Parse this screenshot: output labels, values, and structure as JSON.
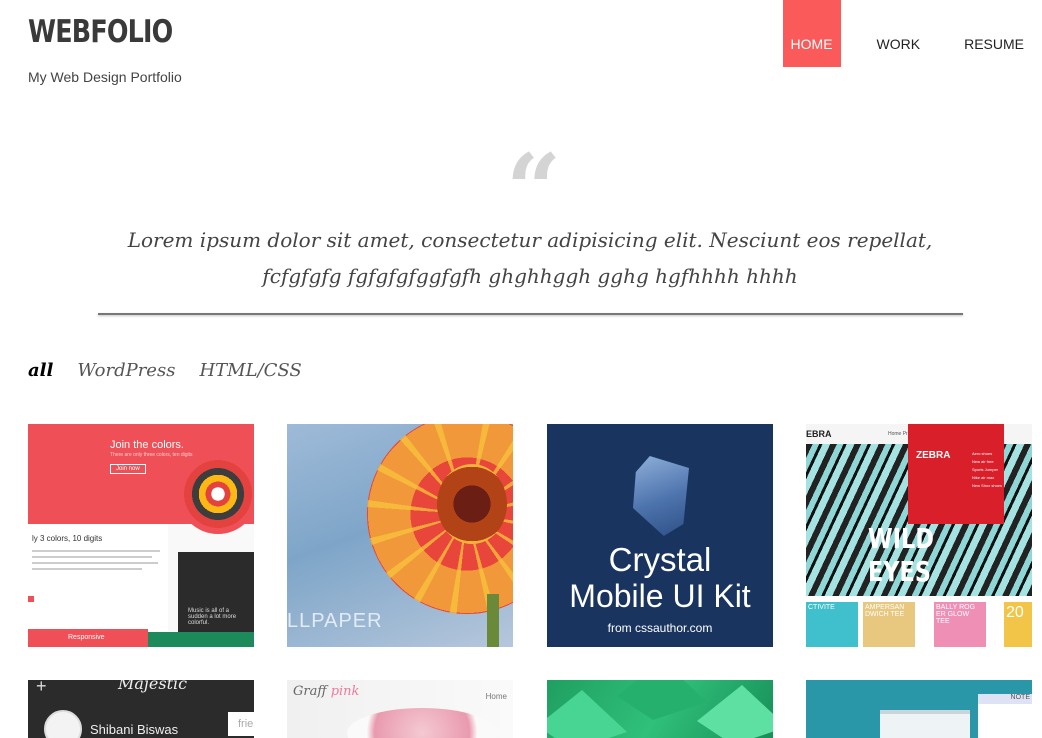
{
  "header": {
    "logo": "WEBFOLIO",
    "tagline": "My Web Design Portfolio",
    "nav": [
      {
        "label": "HOME",
        "active": true
      },
      {
        "label": "WORK",
        "active": false
      },
      {
        "label": "RESUME",
        "active": false
      }
    ]
  },
  "quote": {
    "mark": "“",
    "text": "Lorem ipsum dolor sit amet, consectetur adipisicing elit. Nesciunt eos repellat, fcfgfgfg fgfgfgfggfgfh ghghhggh gghg hgfhhhh hhhh"
  },
  "filters": [
    {
      "label": "all",
      "active": true
    },
    {
      "label": "WordPress",
      "active": false
    },
    {
      "label": "HTML/CSS",
      "active": false
    }
  ],
  "portfolio": {
    "tile1": {
      "heading": "Join the colors.",
      "sub": "There are only three colors, ten digits",
      "button": "Join now",
      "body_heading": "ly 3 colors, 10 digits",
      "footer": "Responsive",
      "music": "Music is all of a sudden a lot more colorful."
    },
    "tile2": {
      "caption": "LLPAPER"
    },
    "tile3": {
      "line1": "Crystal",
      "line2": "Mobile UI Kit",
      "credit": "from cssauthor.com"
    },
    "tile4": {
      "brand": "EBRA",
      "nav": "Home  Products  Shopping  Contact",
      "panel_title": "ZEBRA",
      "list": [
        "Aero shoes",
        "New air free",
        "Sports Jumper",
        "Nike air max",
        "New Shox shoes"
      ],
      "headline": "WILD EYES",
      "products": [
        "CTIVITE",
        "AMPERSAN DWICH TEE",
        "BALLY ROG ER GLOW TEE",
        "20"
      ]
    },
    "tile5": {
      "plus": "+",
      "title": "Majestic",
      "name": "Shibani Biswas",
      "input": "frie"
    },
    "tile6": {
      "brand_a": "Graff",
      "brand_b": "pink",
      "home": "Home"
    },
    "tile8": {
      "note": "NOTE"
    }
  },
  "colors": {
    "accent": "#fb5a5a",
    "quote_mark": "#d4d4d4",
    "text": "#333333"
  }
}
